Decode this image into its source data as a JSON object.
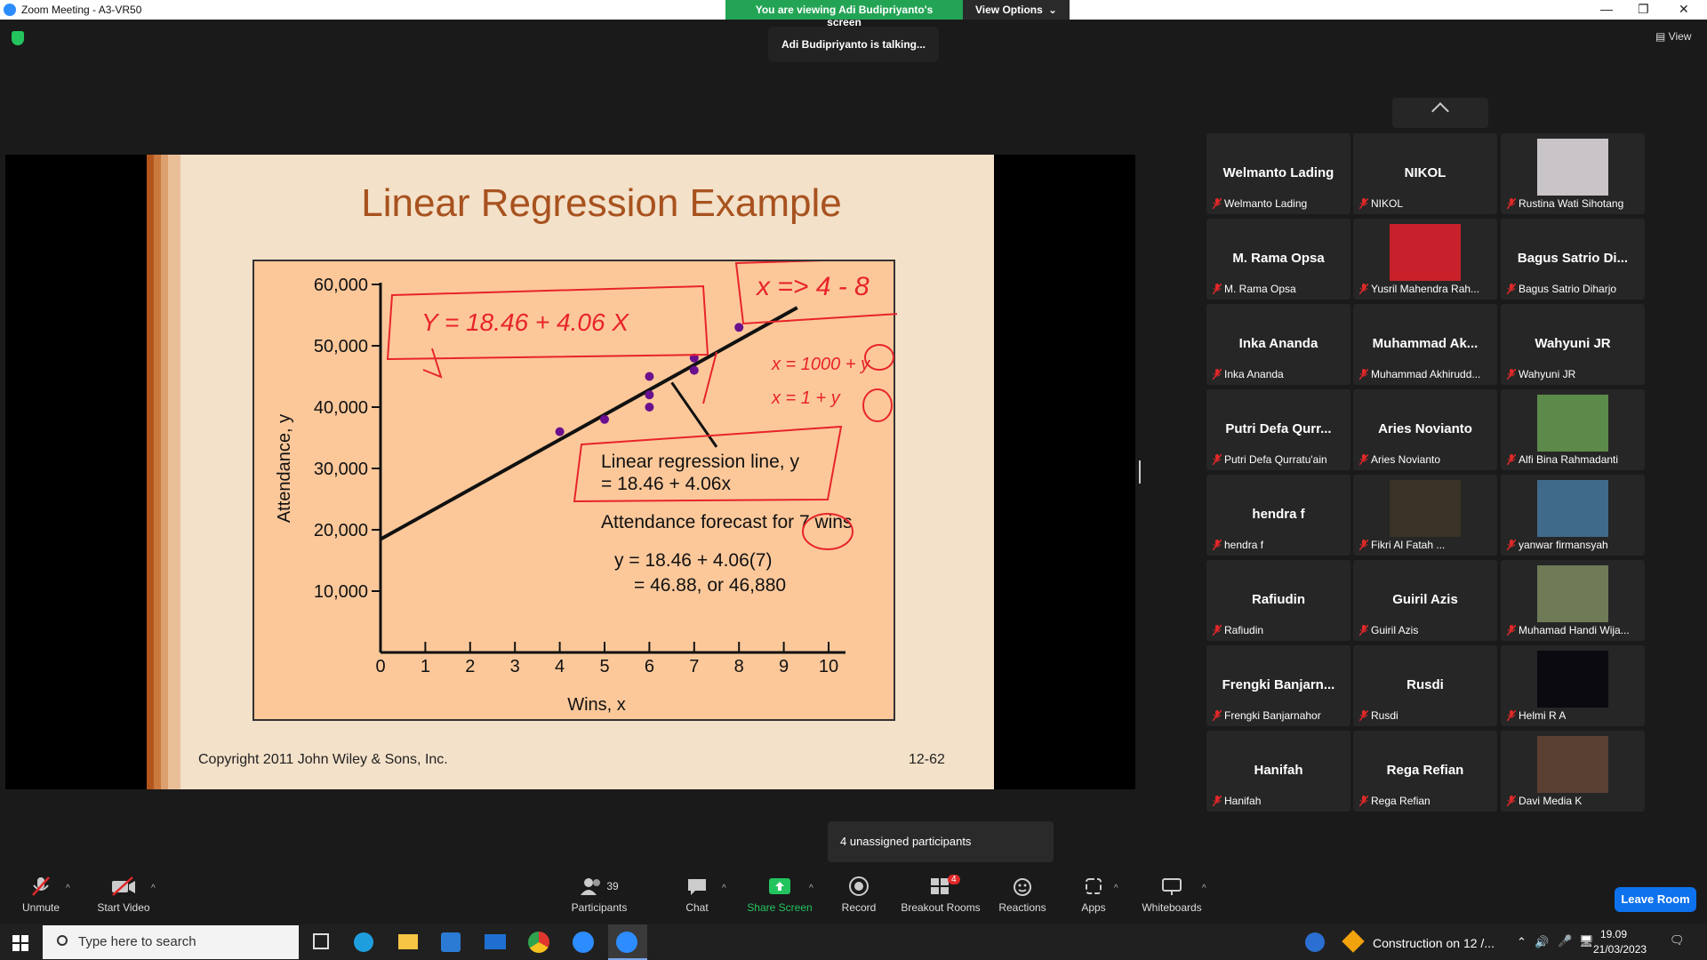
{
  "window": {
    "title": "Zoom Meeting - A3-VR50"
  },
  "share_banner": {
    "viewing": "You are viewing Adi Budipriyanto's screen",
    "options": "View Options"
  },
  "talking": "Adi Budipriyanto is talking...",
  "view_label": "View",
  "slide": {
    "title": "Linear Regression Example",
    "copyright": "Copyright 2011 John Wiley & Sons, Inc.",
    "page": "12-62",
    "colors": {
      "background": "#f3e1c9",
      "plot": "#fcc89a",
      "title": "#a8521f",
      "ink": "#e8242a",
      "dots": "#6a0f8e"
    }
  },
  "chart_data": {
    "type": "scatter",
    "xlabel": "Wins, x",
    "ylabel": "Attendance, y",
    "xlim": [
      0,
      10
    ],
    "ylim": [
      0,
      60000
    ],
    "x_ticks": [
      "0",
      "1",
      "2",
      "3",
      "4",
      "5",
      "6",
      "7",
      "8",
      "9",
      "10"
    ],
    "y_ticks": [
      "10,000",
      "20,000",
      "30,000",
      "40,000",
      "50,000",
      "60,000"
    ],
    "points": [
      [
        4,
        36000
      ],
      [
        5,
        38000
      ],
      [
        6,
        40000
      ],
      [
        6,
        42000
      ],
      [
        6,
        45000
      ],
      [
        7,
        46000
      ],
      [
        7,
        48000
      ],
      [
        8,
        53000
      ]
    ],
    "regression": {
      "intercept": 18.46,
      "slope": 4.06,
      "x_range": [
        0,
        9.3
      ]
    },
    "annotations": {
      "line_label_1": "Linear regression line, y",
      "line_label_2": "= 18.46 + 4.06x",
      "forecast_title": "Attendance forecast for 7 wins",
      "forecast_1": "y = 18.46 + 4.06(7)",
      "forecast_2": "= 46.88, or 46,880"
    },
    "handwriting": {
      "equation": "Y = 18.46 + 4.06 X",
      "range": "x => 4 - 8",
      "note_1": "x = 1000 + y",
      "note_2": "x = 1 + y"
    }
  },
  "gallery": {
    "tiles": [
      {
        "big": "Welmanto Lading",
        "label": "Welmanto Lading",
        "photo": false
      },
      {
        "big": "NIKOL",
        "label": "NIKOL",
        "photo": false
      },
      {
        "big": "",
        "label": "Rustina Wati Sihotang",
        "photo": true,
        "color": "#c9c4c8"
      },
      {
        "big": "M. Rama Opsa",
        "label": "M. Rama Opsa",
        "photo": false
      },
      {
        "big": "",
        "label": "Yusril Mahendra Rah...",
        "photo": true,
        "color": "#c8212b"
      },
      {
        "big": "Bagus Satrio Di...",
        "label": "Bagus Satrio Diharjo",
        "photo": false
      },
      {
        "big": "Inka Ananda",
        "label": "Inka Ananda",
        "photo": false
      },
      {
        "big": "Muhammad Ak...",
        "label": "Muhammad Akhirudd...",
        "photo": false
      },
      {
        "big": "Wahyuni JR",
        "label": "Wahyuni JR",
        "photo": false
      },
      {
        "big": "Putri Defa Qurr...",
        "label": "Putri Defa Qurratu'ain",
        "photo": false
      },
      {
        "big": "Aries Novianto",
        "label": "Aries Novianto",
        "photo": false
      },
      {
        "big": "",
        "label": "Alfi Bina Rahmadanti",
        "photo": true,
        "color": "#5b8a4a"
      },
      {
        "big": "hendra f",
        "label": "hendra f",
        "photo": false
      },
      {
        "big": "",
        "label": "Fikri Al Fatah ...",
        "photo": true,
        "color": "#3a3226"
      },
      {
        "big": "",
        "label": "yanwar firmansyah",
        "photo": true,
        "color": "#3f6a8a"
      },
      {
        "big": "Rafiudin",
        "label": "Rafiudin",
        "photo": false
      },
      {
        "big": "Guiril Azis",
        "label": "Guiril Azis",
        "photo": false
      },
      {
        "big": "",
        "label": "Muhamad Handi Wija...",
        "photo": true,
        "color": "#6f7a57"
      },
      {
        "big": "Frengki Banjarn...",
        "label": "Frengki Banjarnahor",
        "photo": false
      },
      {
        "big": "Rusdi",
        "label": "Rusdi",
        "photo": false
      },
      {
        "big": "",
        "label": "Helmi R A",
        "photo": true,
        "color": "#0a0a10"
      },
      {
        "big": "Hanifah",
        "label": "Hanifah",
        "photo": false
      },
      {
        "big": "Rega Refian",
        "label": "Rega Refian",
        "photo": false
      },
      {
        "big": "",
        "label": "Davi Media K",
        "photo": true,
        "color": "#5a4032"
      }
    ]
  },
  "unassigned": "4 unassigned participants",
  "toolbar": {
    "unmute": "Unmute",
    "start_video": "Start Video",
    "participants": "Participants",
    "participants_count": "39",
    "chat": "Chat",
    "share_screen": "Share Screen",
    "record": "Record",
    "breakout": "Breakout Rooms",
    "breakout_badge": "4",
    "reactions": "Reactions",
    "apps": "Apps",
    "whiteboards": "Whiteboards",
    "leave": "Leave Room"
  },
  "taskbar": {
    "search_placeholder": "Type here to search",
    "notification": "Construction on 12 /...",
    "time": "19.09",
    "date": "21/03/2023"
  }
}
